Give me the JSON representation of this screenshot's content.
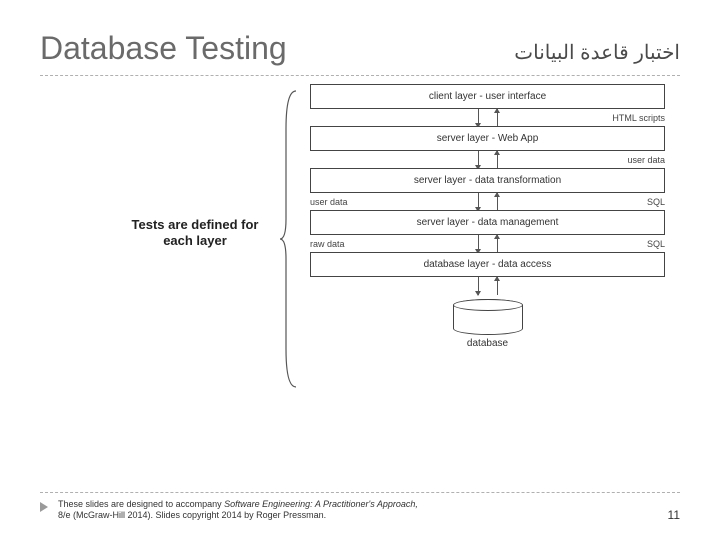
{
  "header": {
    "title": "Database Testing",
    "subtitle_ar": "اختبار قاعدة البيانات"
  },
  "side_label_line1": "Tests are defined for",
  "side_label_line2": "each layer",
  "layers": [
    {
      "name": "client layer - user interface"
    },
    {
      "name": "server layer - Web App"
    },
    {
      "name": "server layer - data transformation"
    },
    {
      "name": "server layer - data management"
    },
    {
      "name": "database layer - data access"
    }
  ],
  "inter": [
    {
      "left": "",
      "right": "HTML scripts"
    },
    {
      "left": "",
      "right": "user data"
    },
    {
      "left": "user data",
      "right": "SQL"
    },
    {
      "left": "raw data",
      "right": "SQL"
    },
    {
      "left": "",
      "right": ""
    }
  ],
  "db_label": "database",
  "footer": {
    "line1a": "These slides are designed to accompany ",
    "line1b_italic": "Software Engineering: A Practitioner's Approach,",
    "line2": "8/e (McGraw-Hill 2014). Slides copyright 2014 by Roger Pressman."
  },
  "page_number": "11"
}
